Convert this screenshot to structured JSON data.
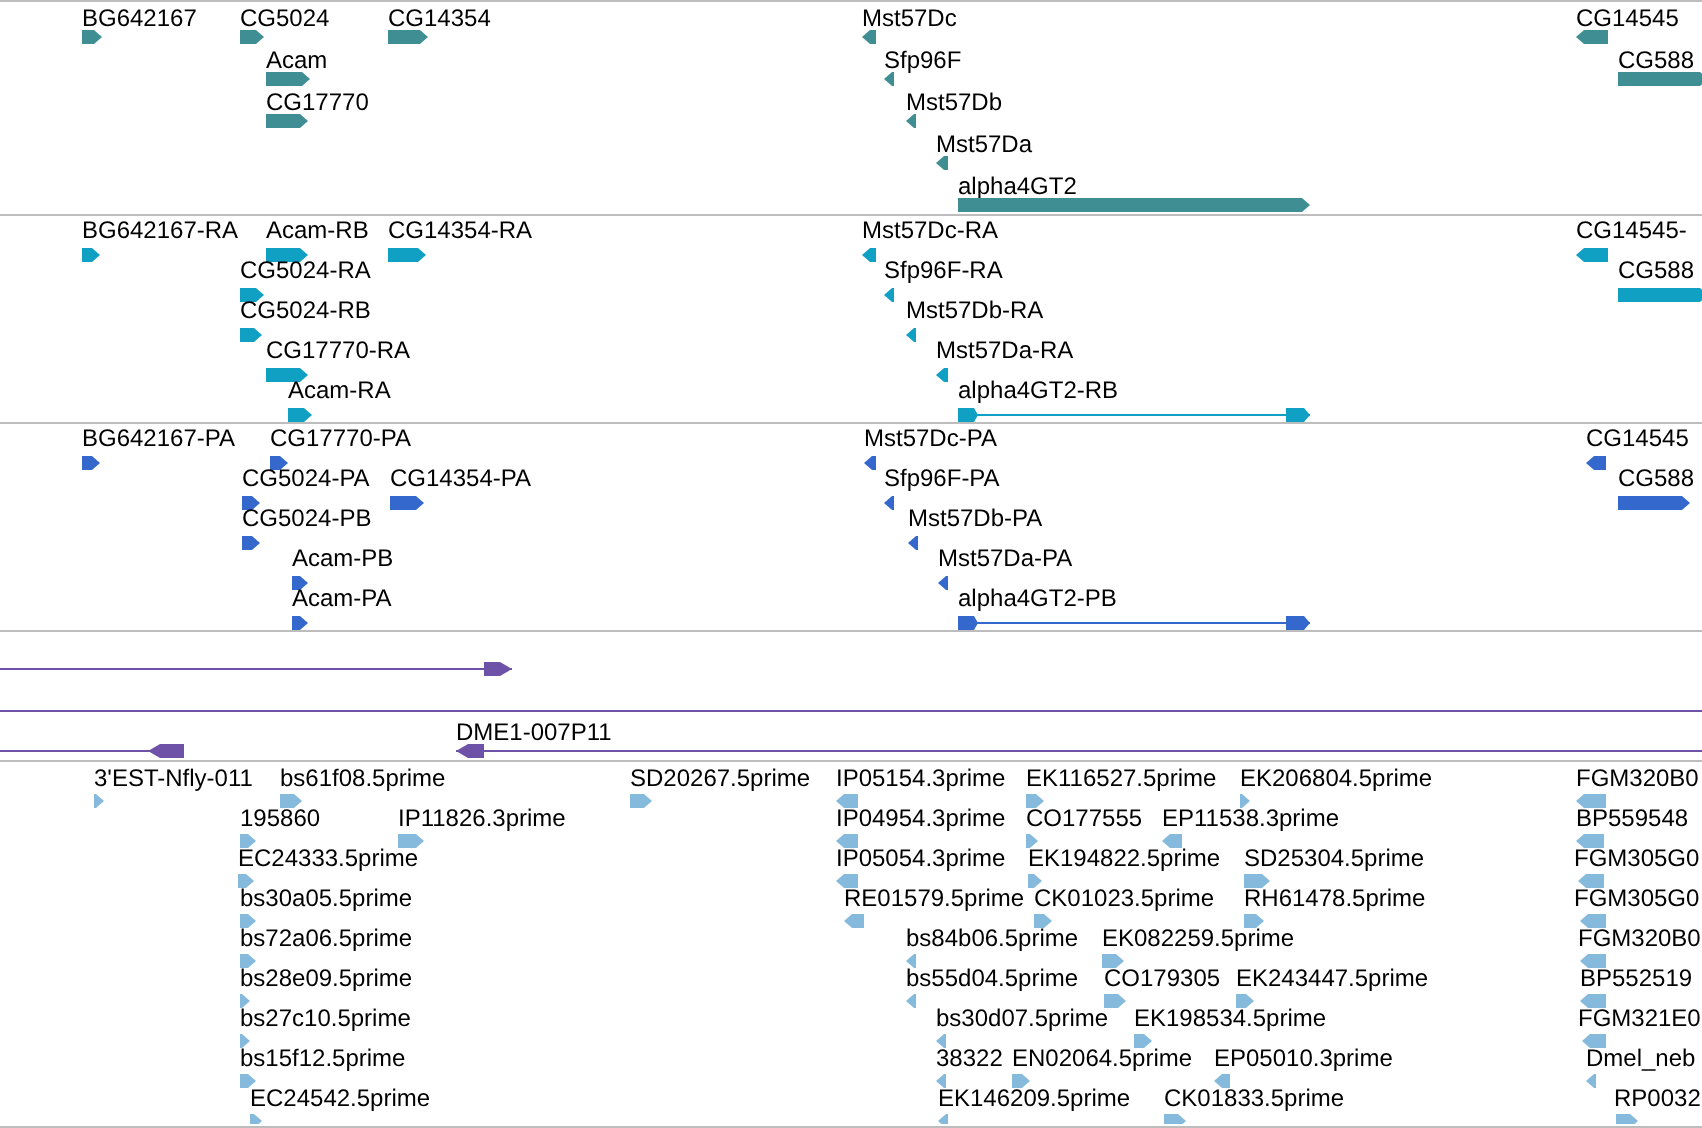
{
  "tracks": [
    {
      "kind": "gene",
      "features": [
        {
          "label": "BG642167",
          "reverse": false
        },
        {
          "label": "CG5024",
          "reverse": false
        },
        {
          "label": "CG14354",
          "reverse": false
        },
        {
          "label": "Acam",
          "reverse": false
        },
        {
          "label": "CG17770",
          "reverse": false
        },
        {
          "label": "Mst57Dc",
          "reverse": true
        },
        {
          "label": "Sfp96F",
          "reverse": true
        },
        {
          "label": "Mst57Db",
          "reverse": true
        },
        {
          "label": "Mst57Da",
          "reverse": true
        },
        {
          "label": "alpha4GT2",
          "reverse": false
        },
        {
          "label": "CG14545",
          "reverse": true
        },
        {
          "label": "CG588",
          "reverse": false
        }
      ]
    },
    {
      "kind": "transcript",
      "features": [
        {
          "label": "BG642167-RA",
          "reverse": false
        },
        {
          "label": "Acam-RB",
          "reverse": false
        },
        {
          "label": "CG14354-RA",
          "reverse": false
        },
        {
          "label": "CG5024-RA",
          "reverse": false
        },
        {
          "label": "CG5024-RB",
          "reverse": false
        },
        {
          "label": "CG17770-RA",
          "reverse": false
        },
        {
          "label": "Acam-RA",
          "reverse": false
        },
        {
          "label": "Mst57Dc-RA",
          "reverse": true
        },
        {
          "label": "Sfp96F-RA",
          "reverse": true
        },
        {
          "label": "Mst57Db-RA",
          "reverse": true
        },
        {
          "label": "Mst57Da-RA",
          "reverse": true
        },
        {
          "label": "alpha4GT2-RB",
          "reverse": false
        },
        {
          "label": "CG14545-",
          "reverse": true
        },
        {
          "label": "CG588",
          "reverse": false
        }
      ]
    },
    {
      "kind": "protein",
      "features": [
        {
          "label": "BG642167-PA",
          "reverse": false
        },
        {
          "label": "CG17770-PA",
          "reverse": false
        },
        {
          "label": "CG5024-PA",
          "reverse": false
        },
        {
          "label": "CG14354-PA",
          "reverse": false
        },
        {
          "label": "CG5024-PB",
          "reverse": false
        },
        {
          "label": "Acam-PB",
          "reverse": false
        },
        {
          "label": "Acam-PA",
          "reverse": false
        },
        {
          "label": "Mst57Dc-PA",
          "reverse": true
        },
        {
          "label": "Sfp96F-PA",
          "reverse": true
        },
        {
          "label": "Mst57Db-PA",
          "reverse": true
        },
        {
          "label": "Mst57Da-PA",
          "reverse": true
        },
        {
          "label": "alpha4GT2-PB",
          "reverse": false
        },
        {
          "label": "CG14545",
          "reverse": true
        },
        {
          "label": "CG588",
          "reverse": false
        }
      ]
    },
    {
      "kind": "clone",
      "features": [
        {
          "reverse": false
        },
        {
          "reverse": false
        },
        {
          "reverse": true
        },
        {
          "label": "DME1-007P11",
          "reverse": true
        }
      ]
    },
    {
      "kind": "est",
      "features": [
        {
          "label": "3'EST-Nfly-011",
          "reverse": false
        },
        {
          "label": "bs61f08.5prime",
          "reverse": false
        },
        {
          "label": "SD20267.5prime",
          "reverse": false
        },
        {
          "label": "IP05154.3prime",
          "reverse": true
        },
        {
          "label": "EK116527.5prime",
          "reverse": false
        },
        {
          "label": "EK206804.5prime",
          "reverse": false
        },
        {
          "label": "FGM320B0",
          "reverse": true
        },
        {
          "label": "195860",
          "reverse": false
        },
        {
          "label": "IP11826.3prime",
          "reverse": false
        },
        {
          "label": "IP04954.3prime",
          "reverse": true
        },
        {
          "label": "CO177555",
          "reverse": false
        },
        {
          "label": "EP11538.3prime",
          "reverse": true
        },
        {
          "label": "BP559548",
          "reverse": true
        },
        {
          "label": "EC24333.5prime",
          "reverse": false
        },
        {
          "label": "IP05054.3prime",
          "reverse": true
        },
        {
          "label": "EK194822.5prime",
          "reverse": false
        },
        {
          "label": "SD25304.5prime",
          "reverse": false
        },
        {
          "label": "FGM305G0",
          "reverse": true
        },
        {
          "label": "bs30a05.5prime",
          "reverse": false
        },
        {
          "label": "RE01579.5prime",
          "reverse": true
        },
        {
          "label": "CK01023.5prime",
          "reverse": false
        },
        {
          "label": "RH61478.5prime",
          "reverse": false
        },
        {
          "label": "FGM305G0",
          "reverse": true
        },
        {
          "label": "bs72a06.5prime",
          "reverse": false
        },
        {
          "label": "bs84b06.5prime",
          "reverse": true
        },
        {
          "label": "EK082259.5prime",
          "reverse": false
        },
        {
          "label": "FGM320B0",
          "reverse": true
        },
        {
          "label": "bs28e09.5prime",
          "reverse": false
        },
        {
          "label": "bs55d04.5prime",
          "reverse": true
        },
        {
          "label": "CO179305",
          "reverse": false
        },
        {
          "label": "EK243447.5prime",
          "reverse": false
        },
        {
          "label": "BP552519",
          "reverse": true
        },
        {
          "label": "bs27c10.5prime",
          "reverse": false
        },
        {
          "label": "bs30d07.5prime",
          "reverse": true
        },
        {
          "label": "EK198534.5prime",
          "reverse": false
        },
        {
          "label": "FGM321E0",
          "reverse": true
        },
        {
          "label": "bs15f12.5prime",
          "reverse": false
        },
        {
          "label": "38322",
          "reverse": true
        },
        {
          "label": "EN02064.5prime",
          "reverse": false
        },
        {
          "label": "EP05010.3prime",
          "reverse": true
        },
        {
          "label": "Dmel_neb",
          "reverse": true
        },
        {
          "label": "EC24542.5prime",
          "reverse": false
        },
        {
          "label": "EK146209.5prime",
          "reverse": true
        },
        {
          "label": "CK01833.5prime",
          "reverse": false
        },
        {
          "label": "RP0032",
          "reverse": false
        }
      ]
    }
  ]
}
